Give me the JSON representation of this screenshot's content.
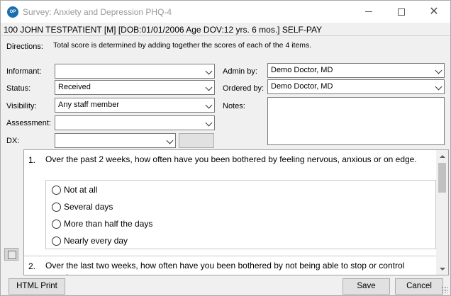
{
  "window": {
    "title": "Survey: Anxiety and Depression PHQ-4",
    "icon_name": "app-logo-icon",
    "icon_text": "OP"
  },
  "patient": {
    "banner": "100 JOHN TESTPATIENT [M] [DOB:01/01/2006  Age DOV:12 yrs. 6 mos.] SELF-PAY"
  },
  "directions": {
    "label": "Directions:",
    "text": "Total score is determined by adding together the scores of each of the 4 items."
  },
  "form": {
    "informant": {
      "label": "Informant:",
      "value": ""
    },
    "status": {
      "label": "Status:",
      "value": "Received"
    },
    "visibility": {
      "label": "Visibility:",
      "value": "Any staff member"
    },
    "assessment": {
      "label": "Assessment:",
      "value": ""
    },
    "dx": {
      "label": "DX:",
      "value": ""
    },
    "admin_by": {
      "label": "Admin by:",
      "value": "Demo Doctor, MD"
    },
    "ordered_by": {
      "label": "Ordered by:",
      "value": "Demo Doctor, MD"
    },
    "notes": {
      "label": "Notes:",
      "value": ""
    }
  },
  "questions": [
    {
      "number": "1.",
      "text": "Over the past 2 weeks, how often have you been bothered by feeling nervous, anxious or on edge.",
      "options": [
        "Not at all",
        "Several days",
        "More than half the days",
        "Nearly every day"
      ]
    },
    {
      "number": "2.",
      "text": "Over the last two weeks, how often have you been bothered by not being able to stop or control worrying."
    }
  ],
  "buttons": {
    "html_print": "HTML Print",
    "save": "Save",
    "cancel": "Cancel"
  }
}
